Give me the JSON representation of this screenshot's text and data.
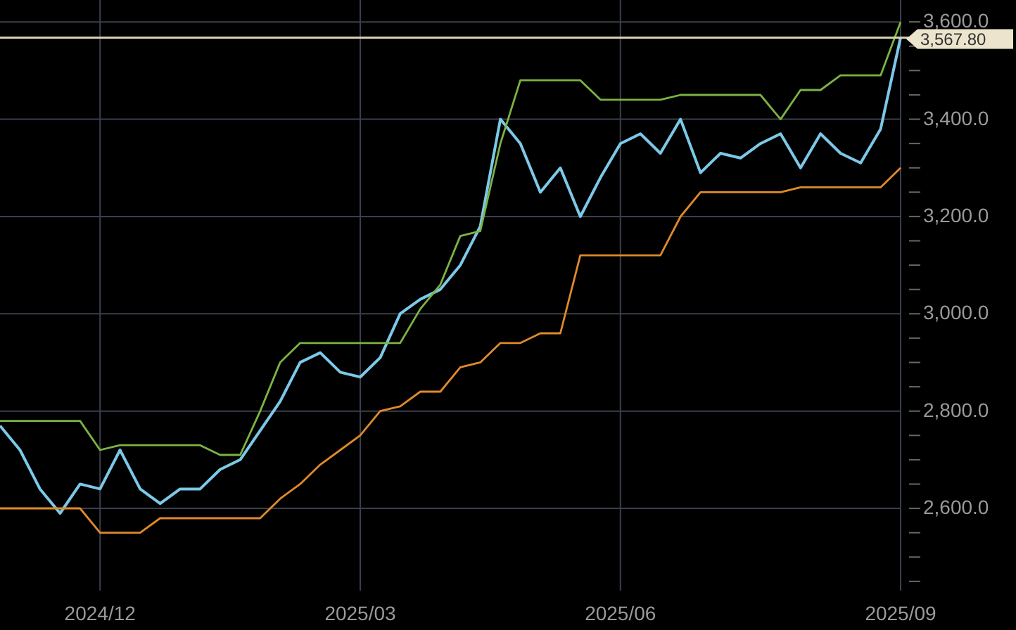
{
  "chart": {
    "last_price": "3,567.80",
    "chart_data": {
      "type": "line",
      "grid": true,
      "ref_lines": [
        {
          "axis": "y",
          "value": 3567.8,
          "color": "#d8d0b4"
        }
      ],
      "categories": [
        null,
        null,
        null,
        null,
        null,
        "2024/12",
        null,
        null,
        null,
        null,
        null,
        null,
        null,
        null,
        null,
        null,
        null,
        null,
        "2025/03",
        null,
        null,
        null,
        null,
        null,
        null,
        null,
        null,
        null,
        null,
        null,
        null,
        "2025/06",
        null,
        null,
        null,
        null,
        null,
        null,
        null,
        null,
        null,
        null,
        null,
        null,
        null,
        "2025/09"
      ],
      "yticks": [
        {
          "value": 2600,
          "label": "2,600.0"
        },
        {
          "value": 2800,
          "label": "2,800.0"
        },
        {
          "value": 3000,
          "label": "3,000.0"
        },
        {
          "value": 3200,
          "label": "3,200.0"
        },
        {
          "value": 3400,
          "label": "3,400.0"
        },
        {
          "value": 3600,
          "label": "3,600.0"
        }
      ],
      "ylim": [
        2431,
        3645
      ],
      "series": [
        {
          "color": "#7cc8e8",
          "values": [
            2770,
            2720,
            2640,
            2590,
            2650,
            2640,
            2720,
            2640,
            2610,
            2640,
            2640,
            2680,
            2700,
            2760,
            2820,
            2900,
            2920,
            2880,
            2870,
            2910,
            3000,
            3030,
            3050,
            3100,
            3180,
            3400,
            3350,
            3250,
            3300,
            3200,
            3280,
            3350,
            3370,
            3330,
            3400,
            3290,
            3330,
            3320,
            3350,
            3370,
            3300,
            3370,
            3330,
            3310,
            3380,
            3568
          ]
        },
        {
          "color": "#7cb342",
          "values": [
            2780,
            2780,
            2780,
            2780,
            2780,
            2720,
            2730,
            2730,
            2730,
            2730,
            2730,
            2710,
            2710,
            2800,
            2900,
            2940,
            2940,
            2940,
            2940,
            2940,
            2940,
            3010,
            3060,
            3160,
            3170,
            3350,
            3480,
            3480,
            3480,
            3480,
            3440,
            3440,
            3440,
            3440,
            3450,
            3450,
            3450,
            3450,
            3450,
            3400,
            3460,
            3460,
            3490,
            3490,
            3490,
            3600
          ]
        },
        {
          "color": "#e08a2a",
          "values": [
            2600,
            2600,
            2600,
            2600,
            2600,
            2550,
            2550,
            2550,
            2580,
            2580,
            2580,
            2580,
            2580,
            2580,
            2620,
            2650,
            2690,
            2720,
            2750,
            2800,
            2810,
            2840,
            2840,
            2890,
            2900,
            2940,
            2940,
            2960,
            2960,
            3120,
            3120,
            3120,
            3120,
            3120,
            3200,
            3250,
            3250,
            3250,
            3250,
            3250,
            3260,
            3260,
            3260,
            3260,
            3260,
            3300
          ]
        }
      ]
    }
  }
}
